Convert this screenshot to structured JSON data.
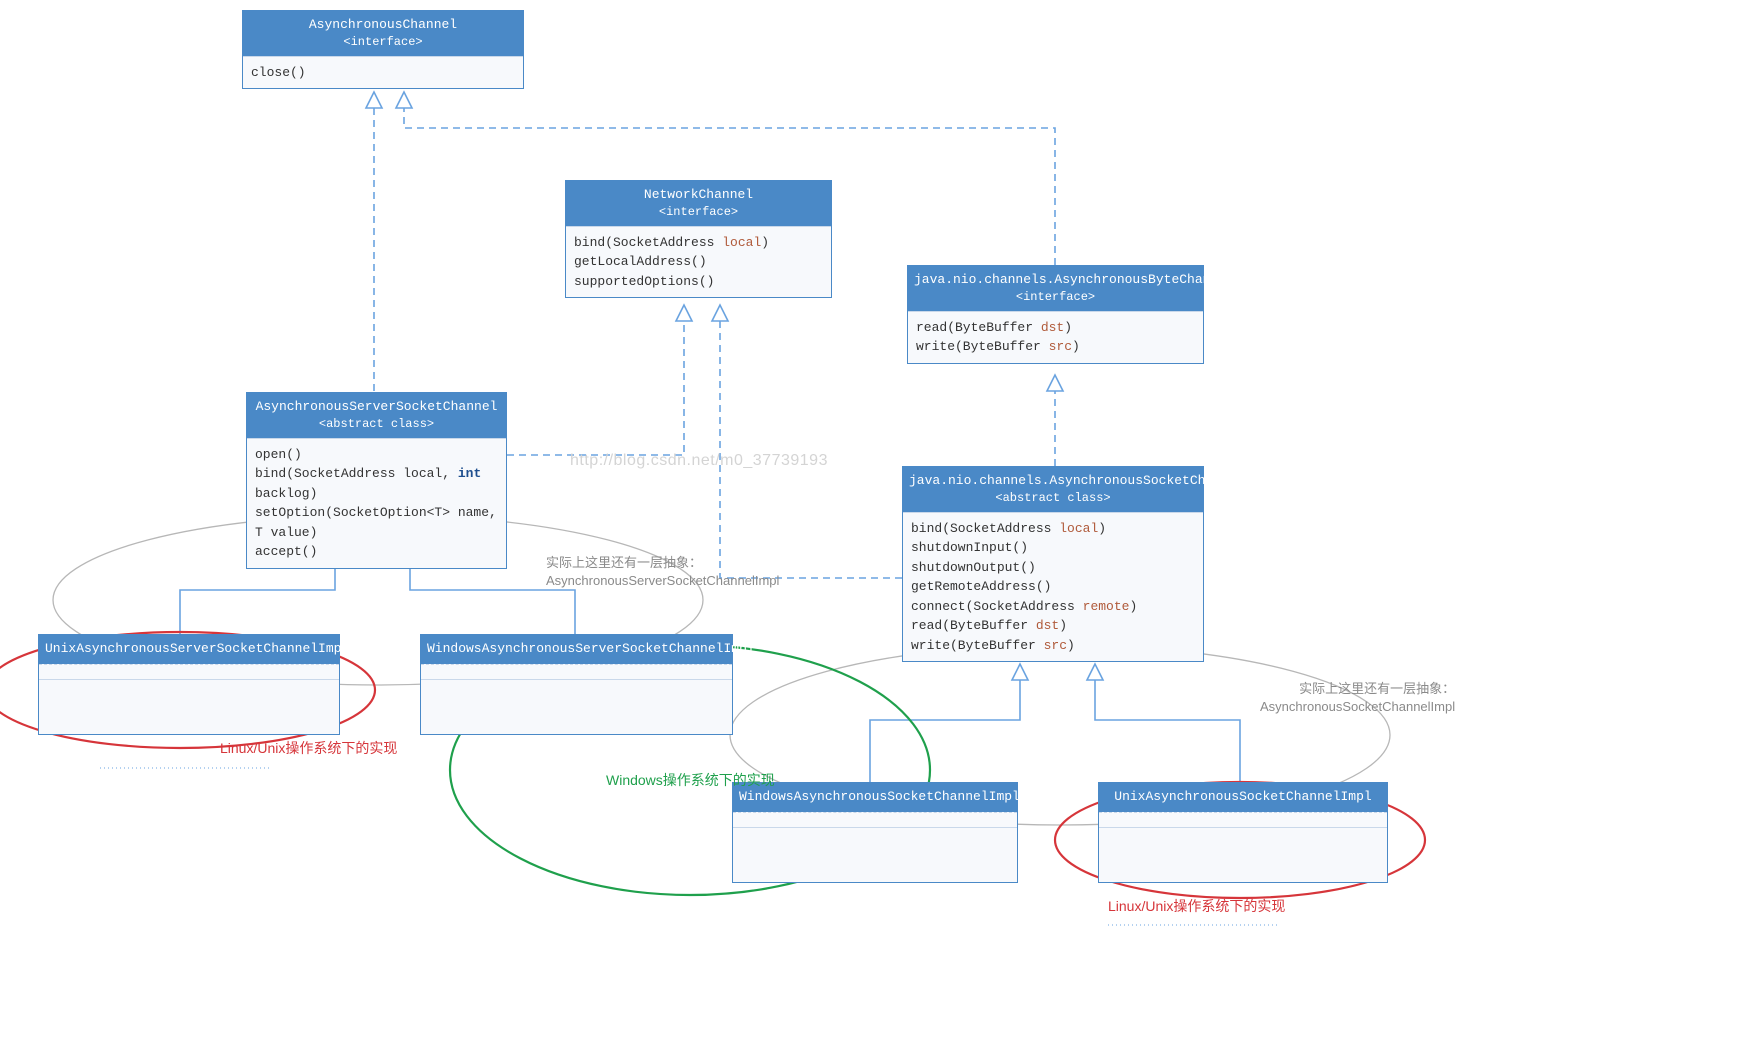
{
  "boxes": {
    "asyncChannel": {
      "title": "AsynchronousChannel",
      "stereo": "<interface>",
      "methods": [
        "close()"
      ]
    },
    "networkChannel": {
      "title": "NetworkChannel",
      "stereo": "<interface>",
      "methods_html": "bind(SocketAddress <span class='kw-local'>local</span>)<br>getLocalAddress()<br>supportedOptions()"
    },
    "asyncByteChannel": {
      "title": "java.nio.channels.AsynchronousByteChannel",
      "stereo": "<interface>",
      "methods_html": "read(ByteBuffer <span class='kw-dst'>dst</span>)<br>write(ByteBuffer <span class='kw-src'>src</span>)"
    },
    "asyncServerSocketChannel": {
      "title": "AsynchronousServerSocketChannel",
      "stereo": "<abstract class>",
      "methods_html": "open()<br>bind(SocketAddress local, <span class='kw-int'>int</span> backlog)<br>setOption(SocketOption&lt;T&gt; name, T value)<br>accept()"
    },
    "asyncSocketChannel": {
      "title": "java.nio.channels.AsynchronousSocketChannel",
      "stereo": "<abstract class>",
      "methods_html": "bind(SocketAddress <span class='kw-local'>local</span>)<br>shutdownInput()<br>shutdownOutput()<br>getRemoteAddress()<br>connect(SocketAddress <span class='kw-remote'>remote</span>)<br>read(ByteBuffer <span class='kw-dst'>dst</span>)<br>write(ByteBuffer <span class='kw-src'>src</span>)"
    },
    "unixServerImpl": {
      "title": "UnixAsynchronousServerSocketChannelImpl"
    },
    "winServerImpl": {
      "title": "WindowsAsynchronousServerSocketChannelImpl"
    },
    "winSocketImpl": {
      "title": "WindowsAsynchronousSocketChannelImpl"
    },
    "unixSocketImpl": {
      "title": "UnixAsynchronousSocketChannelImpl"
    }
  },
  "annotations": {
    "serverImplNote": "实际上这里还有一层抽象：\nAsynchronousServerSocketChannelImpl",
    "socketImplNote": "实际上这里还有一层抽象：\nAsynchronousSocketChannelImpl",
    "linuxUnixNote": "Linux/Unix操作系统下的实现",
    "windowsNote": "Windows操作系统下的实现",
    "linuxUnixNote2": "Linux/Unix操作系统下的实现"
  },
  "watermark": "http://blog.csdn.net/m0_37739193"
}
